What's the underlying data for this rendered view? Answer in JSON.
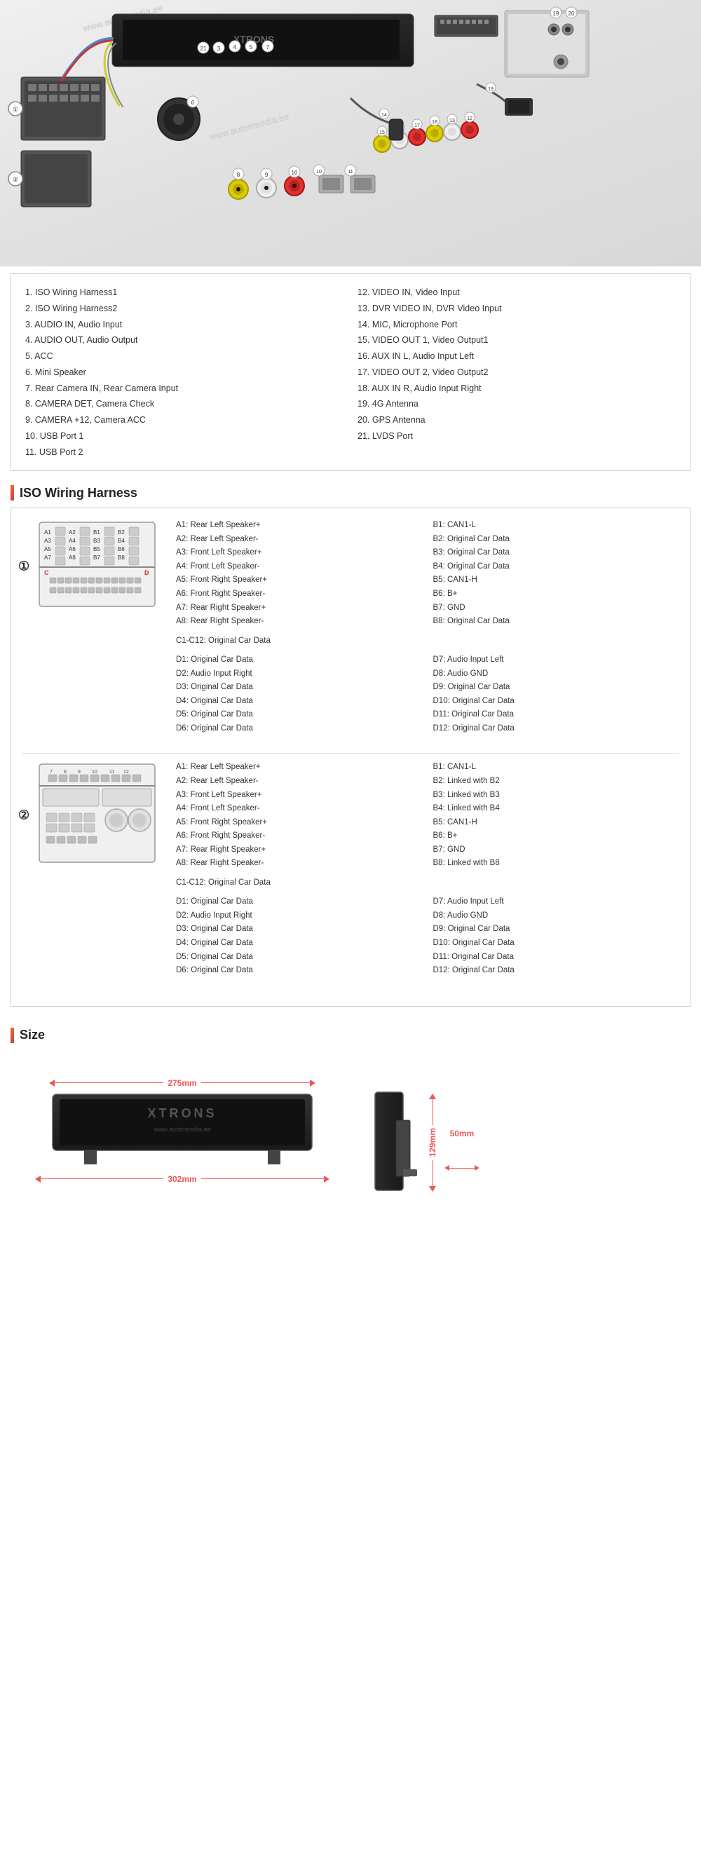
{
  "watermark": "www.automeedia.ee",
  "product_image_alt": "Car Radio Unit with wiring harness",
  "legend": {
    "items_left": [
      "1. ISO Wiring Harness1",
      "2. ISO Wiring Harness2",
      "3. AUDIO IN, Audio Input",
      "4. AUDIO OUT, Audio Output",
      "5. ACC",
      "6. Mini Speaker",
      "7. Rear Camera IN, Rear Camera Input",
      "8. CAMERA DET, Camera Check",
      "9. CAMERA +12, Camera ACC",
      "10. USB Port 1",
      "11. USB Port 2"
    ],
    "items_right": [
      "12. VIDEO IN, Video Input",
      "13. DVR VIDEO IN, DVR Video Input",
      "14. MIC, Microphone Port",
      "15. VIDEO OUT 1, Video Output1",
      "16. AUX IN L, Audio Input Left",
      "17. VIDEO OUT 2, Video Output2",
      "18. AUX IN R, Audio Input Right",
      "19. 4G Antenna",
      "20. GPS Antenna",
      "21. LVDS Port"
    ]
  },
  "iso_wiring": {
    "title": "ISO Wiring Harness",
    "connector1": {
      "number": "①",
      "specs_left": [
        "A1: Rear Left Speaker+",
        "A2: Rear Left Speaker-",
        "A3: Front Left Speaker+",
        "A4: Front Left Speaker-",
        "A5: Front Right Speaker+",
        "A6: Front Right Speaker-",
        "A7: Rear Right Speaker+",
        "A8: Rear Right Speaker-",
        "",
        "C1-C12: Original Car Data",
        "",
        "D1: Original Car Data",
        "D2: Audio Input Right",
        "D3: Original Car Data",
        "D4: Original Car Data",
        "D5: Original Car Data",
        "D6: Original Car Data"
      ],
      "specs_right": [
        "B1: CAN1-L",
        "B2: Original Car Data",
        "B3: Original Car Data",
        "B4: Original Car Data",
        "B5: CAN1-H",
        "B6: B+",
        "B7: GND",
        "B8: Original Car Data",
        "",
        "",
        "",
        "D7: Audio Input Left",
        "D8: Audio GND",
        "D9: Original Car Data",
        "D10: Original Car Data",
        "D11: Original Car Data",
        "D12: Original Car Data"
      ]
    },
    "connector2": {
      "number": "②",
      "specs_left": [
        "A1: Rear Left Speaker+",
        "A2: Rear Left Speaker-",
        "A3: Front Left Speaker+",
        "A4: Front Left Speaker-",
        "A5: Front Right Speaker+",
        "A6: Front Right Speaker-",
        "A7: Rear Right Speaker+",
        "A8: Rear Right Speaker-",
        "",
        "C1-C12: Original Car Data",
        "",
        "D1: Original Car Data",
        "D2: Audio Input Right",
        "D3: Original Car Data",
        "D4: Original Car Data",
        "D5: Original Car Data",
        "D6: Original Car Data"
      ],
      "specs_right": [
        "B1: CAN1-L",
        "B2: Linked with B2",
        "B3: Linked with B3",
        "B4: Linked with B4",
        "B5: CAN1-H",
        "B6: B+",
        "B7: GND",
        "B8: Linked with B8",
        "",
        "",
        "",
        "D7: Audio Input Left",
        "D8: Audio GND",
        "D9: Original Car Data",
        "D10: Original Car Data",
        "D11: Original Car Data",
        "D12: Original Car Data"
      ]
    }
  },
  "size": {
    "title": "Size",
    "dim_top": "275mm",
    "dim_bottom": "302mm",
    "dim_side_height": "129mm",
    "dim_side_width": "50mm",
    "brand": "XTRONS",
    "brand_sub": "www.automeedia.ee"
  }
}
